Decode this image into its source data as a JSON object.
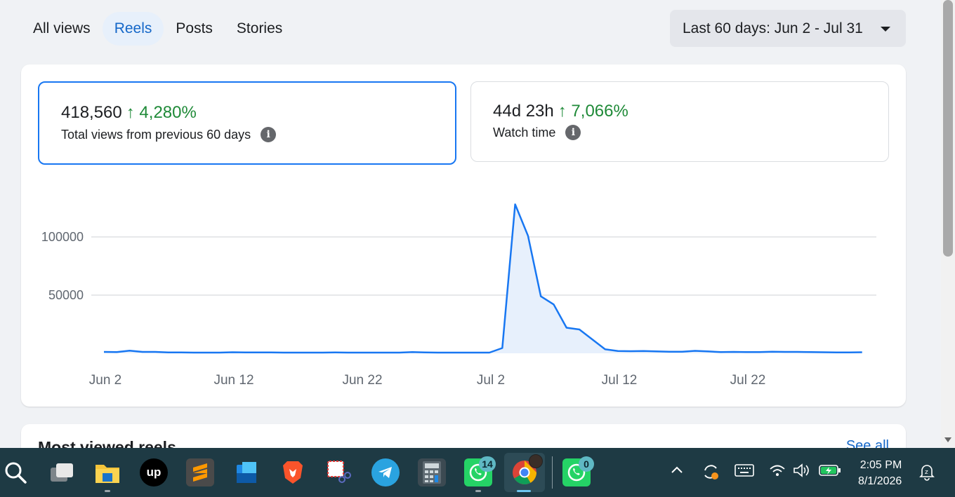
{
  "tabs": [
    {
      "label": "All views",
      "active": false
    },
    {
      "label": "Reels",
      "active": true
    },
    {
      "label": "Posts",
      "active": false
    },
    {
      "label": "Stories",
      "active": false
    }
  ],
  "date_range": {
    "label": "Last 60 days: Jun 2 - Jul 31"
  },
  "metrics": {
    "views": {
      "value": "418,560",
      "change": "↑ 4,280%",
      "label": "Total views from previous 60 days"
    },
    "watch": {
      "value": "44d 23h",
      "change": "↑ 7,066%",
      "label": "Watch time"
    }
  },
  "colors": {
    "accent": "#1877f2",
    "positive": "#1f8a38",
    "link": "#1467c8"
  },
  "chart_data": {
    "type": "area",
    "x_ticks": [
      "Jun 2",
      "Jun 12",
      "Jun 22",
      "Jul 2",
      "Jul 12",
      "Jul 22"
    ],
    "y_ticks": [
      50000,
      100000
    ],
    "ylim": [
      0,
      130000
    ],
    "grid": true,
    "series": [
      {
        "values": [
          1200,
          1100,
          2300,
          1200,
          1200,
          800,
          700,
          600,
          600,
          600,
          900,
          700,
          700,
          700,
          600,
          600,
          600,
          600,
          700,
          600,
          600,
          600,
          600,
          600,
          1000,
          700,
          600,
          600,
          600,
          600,
          600,
          4500,
          128000,
          101000,
          49000,
          42000,
          22000,
          20500,
          12000,
          3500,
          2000,
          1800,
          1900,
          1600,
          1400,
          1400,
          2100,
          1600,
          1000,
          1200,
          1000,
          1000,
          1400,
          1200,
          1200,
          1000,
          900,
          700,
          700,
          900
        ]
      }
    ]
  },
  "next_section": {
    "title": "Most viewed reels",
    "link": "See all"
  },
  "taskbar": {
    "icons": [
      "search-icon",
      "task-view-icon",
      "file-explorer-icon",
      "upwork-icon",
      "sublime-text-icon",
      "windows-store-icon",
      "brave-icon",
      "snipping-tool-icon",
      "telegram-icon",
      "calculator-icon",
      "whatsapp-icon",
      "chrome-icon",
      "whatsapp-business-icon"
    ],
    "whatsapp_badge": "14",
    "whatsapp2_badge": "0",
    "time": "2:05 PM",
    "date": "8/1/2026"
  }
}
